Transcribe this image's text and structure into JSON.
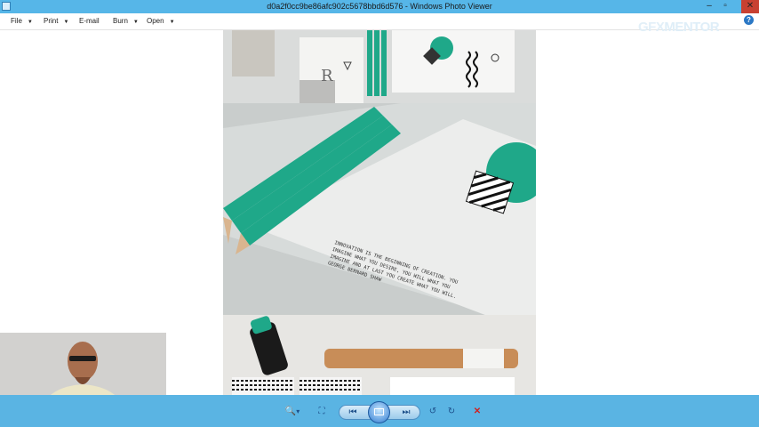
{
  "window": {
    "title": "d0a2f0cc9be86afc902c5678bbd6d576 - Windows Photo Viewer",
    "app_icon": "photo-viewer-icon",
    "controls": {
      "minimize": "–",
      "maximize": "▫",
      "close": "✕"
    }
  },
  "menu": {
    "items": [
      {
        "label": "File",
        "arrow": "▼"
      },
      {
        "label": "Print",
        "arrow": "▼"
      },
      {
        "label": "E-mail"
      },
      {
        "label": "Burn",
        "arrow": "▼"
      },
      {
        "label": "Open",
        "arrow": "▼"
      }
    ],
    "help": "?"
  },
  "watermark": {
    "part1": "GFX",
    "part2": "MENTOR"
  },
  "photo": {
    "description_lines": [
      "INNOVATION IS THE BEGINNING OF CREATION. YOU",
      "IMAGINE WHAT YOU DESIRE, YOU WILL WHAT YOU",
      "IMAGINE AND AT LAST YOU CREATE WHAT YOU WILL.",
      "GEORGE BERNARD SHAW"
    ],
    "accent_color": "#1fa889"
  },
  "toolbar": {
    "zoom": "🔍",
    "zoom_arrow": "▾",
    "fit": "⛶",
    "previous": "⏮",
    "slideshow": "slideshow",
    "next": "⏭",
    "rotate_ccw": "↺",
    "rotate_cw": "↻",
    "delete": "✕"
  }
}
